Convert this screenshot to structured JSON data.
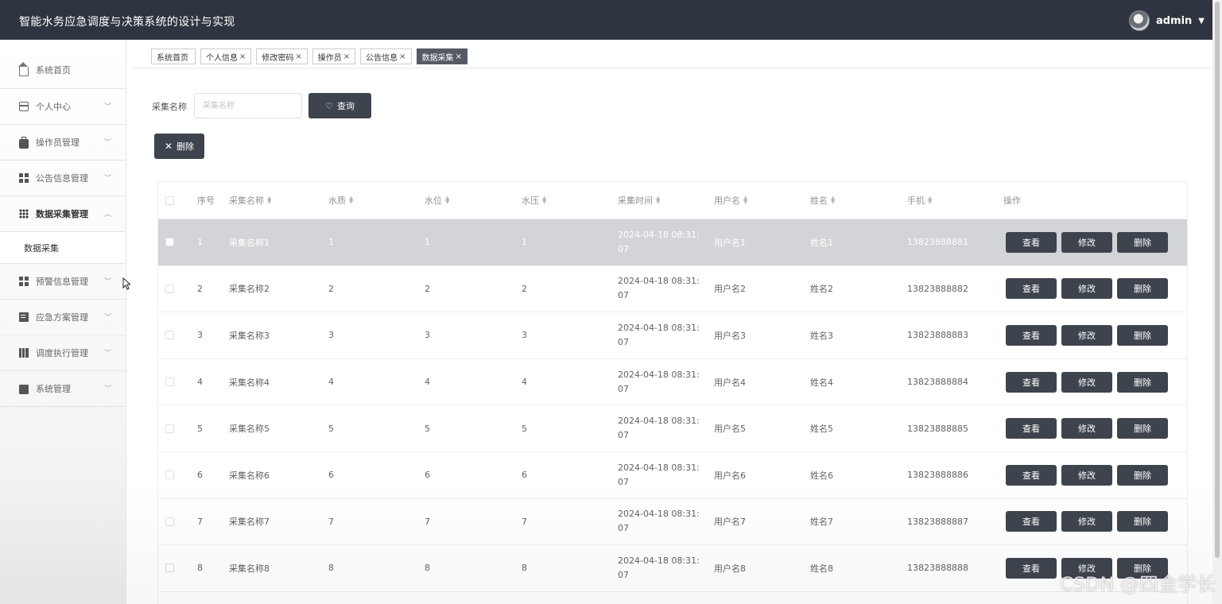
{
  "app": {
    "title": "智能水务应急调度与决策系统的设计与实现"
  },
  "user": {
    "name": "admin",
    "caret": "▼"
  },
  "sidebar": {
    "items": [
      {
        "label": "系统首页",
        "icon": "home-icon"
      },
      {
        "label": "个人中心",
        "icon": "card-icon",
        "chevron": "﹀"
      },
      {
        "label": "操作员管理",
        "icon": "briefcase-icon",
        "chevron": "﹀"
      },
      {
        "label": "公告信息管理",
        "icon": "grid-icon",
        "chevron": "﹀"
      },
      {
        "label": "数据采集管理",
        "icon": "grid9-icon",
        "chevron": "︿"
      },
      {
        "label": "预警信息管理",
        "icon": "grid-icon",
        "chevron": "﹀"
      },
      {
        "label": "应急方案管理",
        "icon": "clipboard-icon",
        "chevron": "﹀"
      },
      {
        "label": "调度执行管理",
        "icon": "bars-icon",
        "chevron": "﹀"
      },
      {
        "label": "系统管理",
        "icon": "monitor-icon",
        "chevron": "﹀"
      }
    ],
    "sub_item": "数据采集"
  },
  "tabs": [
    {
      "label": "系统首页",
      "close": ""
    },
    {
      "label": "个人信息",
      "close": "×"
    },
    {
      "label": "修改密码",
      "close": "×"
    },
    {
      "label": "操作员",
      "close": "×"
    },
    {
      "label": "公告信息",
      "close": "×"
    },
    {
      "label": "数据采集",
      "close": "×"
    }
  ],
  "search": {
    "label": "采集名称",
    "placeholder": "采集名称",
    "button": "查询",
    "button_icon": "♡"
  },
  "toolbar": {
    "delete_label": "删除",
    "delete_icon": "✕"
  },
  "table": {
    "headers": [
      "序号",
      "采集名称",
      "水质",
      "水位",
      "水压",
      "采集时间",
      "用户名",
      "姓名",
      "手机",
      "操作"
    ],
    "sort_glyph_up": "▲",
    "sort_glyph_down": "▼",
    "actions": {
      "view": "查看",
      "edit": "修改",
      "delete": "删除"
    },
    "rows": [
      {
        "no": "1",
        "name": "采集名称1",
        "quality": "1",
        "level": "1",
        "pressure": "1",
        "time": "2024-04-18 08:31:07",
        "username": "用户名1",
        "realname": "姓名1",
        "phone": "13823888881"
      },
      {
        "no": "2",
        "name": "采集名称2",
        "quality": "2",
        "level": "2",
        "pressure": "2",
        "time": "2024-04-18 08:31:07",
        "username": "用户名2",
        "realname": "姓名2",
        "phone": "13823888882"
      },
      {
        "no": "3",
        "name": "采集名称3",
        "quality": "3",
        "level": "3",
        "pressure": "3",
        "time": "2024-04-18 08:31:07",
        "username": "用户名3",
        "realname": "姓名3",
        "phone": "13823888883"
      },
      {
        "no": "4",
        "name": "采集名称4",
        "quality": "4",
        "level": "4",
        "pressure": "4",
        "time": "2024-04-18 08:31:07",
        "username": "用户名4",
        "realname": "姓名4",
        "phone": "13823888884"
      },
      {
        "no": "5",
        "name": "采集名称5",
        "quality": "5",
        "level": "5",
        "pressure": "5",
        "time": "2024-04-18 08:31:07",
        "username": "用户名5",
        "realname": "姓名5",
        "phone": "13823888885"
      },
      {
        "no": "6",
        "name": "采集名称6",
        "quality": "6",
        "level": "6",
        "pressure": "6",
        "time": "2024-04-18 08:31:07",
        "username": "用户名6",
        "realname": "姓名6",
        "phone": "13823888886"
      },
      {
        "no": "7",
        "name": "采集名称7",
        "quality": "7",
        "level": "7",
        "pressure": "7",
        "time": "2024-04-18 08:31:07",
        "username": "用户名7",
        "realname": "姓名7",
        "phone": "13823888887"
      },
      {
        "no": "8",
        "name": "采集名称8",
        "quality": "8",
        "level": "8",
        "pressure": "8",
        "time": "2024-04-18 08:31:07",
        "username": "用户名8",
        "realname": "姓名8",
        "phone": "13823888888"
      }
    ]
  },
  "watermark": "CSDN @四金学长",
  "colors": {
    "topbar": "#2f3540",
    "button": "#3e444d",
    "active_tab": "#555b64",
    "highlight_row": "#d3d4d8"
  }
}
